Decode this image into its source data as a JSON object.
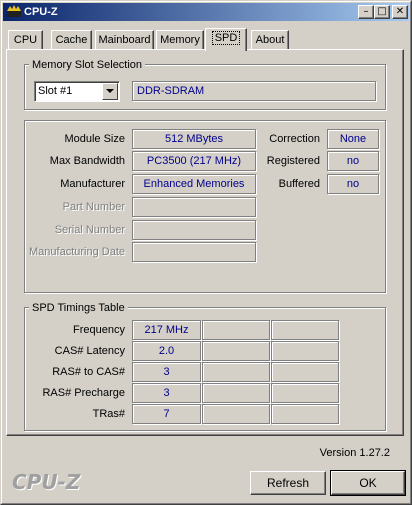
{
  "window": {
    "title": "CPU-Z"
  },
  "titlebar_buttons": {
    "minimize": "–",
    "maximize": "□",
    "close": "✕"
  },
  "tabs": [
    {
      "label": "CPU"
    },
    {
      "label": "Cache"
    },
    {
      "label": "Mainboard"
    },
    {
      "label": "Memory"
    },
    {
      "label": "SPD"
    },
    {
      "label": "About"
    }
  ],
  "active_tab": "SPD",
  "slot_selection": {
    "group_title": "Memory Slot Selection",
    "selected_slot": "Slot #1",
    "memory_type": "DDR-SDRAM"
  },
  "module": {
    "module_size_label": "Module Size",
    "module_size": "512 MBytes",
    "max_bandwidth_label": "Max Bandwidth",
    "max_bandwidth": "PC3500 (217 MHz)",
    "manufacturer_label": "Manufacturer",
    "manufacturer": "Enhanced Memories",
    "part_number_label": "Part Number",
    "part_number": "",
    "serial_number_label": "Serial Number",
    "serial_number": "",
    "manufacturing_date_label": "Manufacturing Date",
    "manufacturing_date": "",
    "correction_label": "Correction",
    "correction": "None",
    "registered_label": "Registered",
    "registered": "no",
    "buffered_label": "Buffered",
    "buffered": "no"
  },
  "timings": {
    "group_title": "SPD Timings Table",
    "rows": [
      {
        "label": "Frequency",
        "value": "217 MHz"
      },
      {
        "label": "CAS# Latency",
        "value": "2.0"
      },
      {
        "label": "RAS# to CAS#",
        "value": "3"
      },
      {
        "label": "RAS# Precharge",
        "value": "3"
      },
      {
        "label": "TRas#",
        "value": "7"
      }
    ]
  },
  "footer": {
    "version": "Version 1.27.2",
    "logo": "CPU-Z",
    "refresh_label": "Refresh",
    "ok_label": "OK"
  }
}
